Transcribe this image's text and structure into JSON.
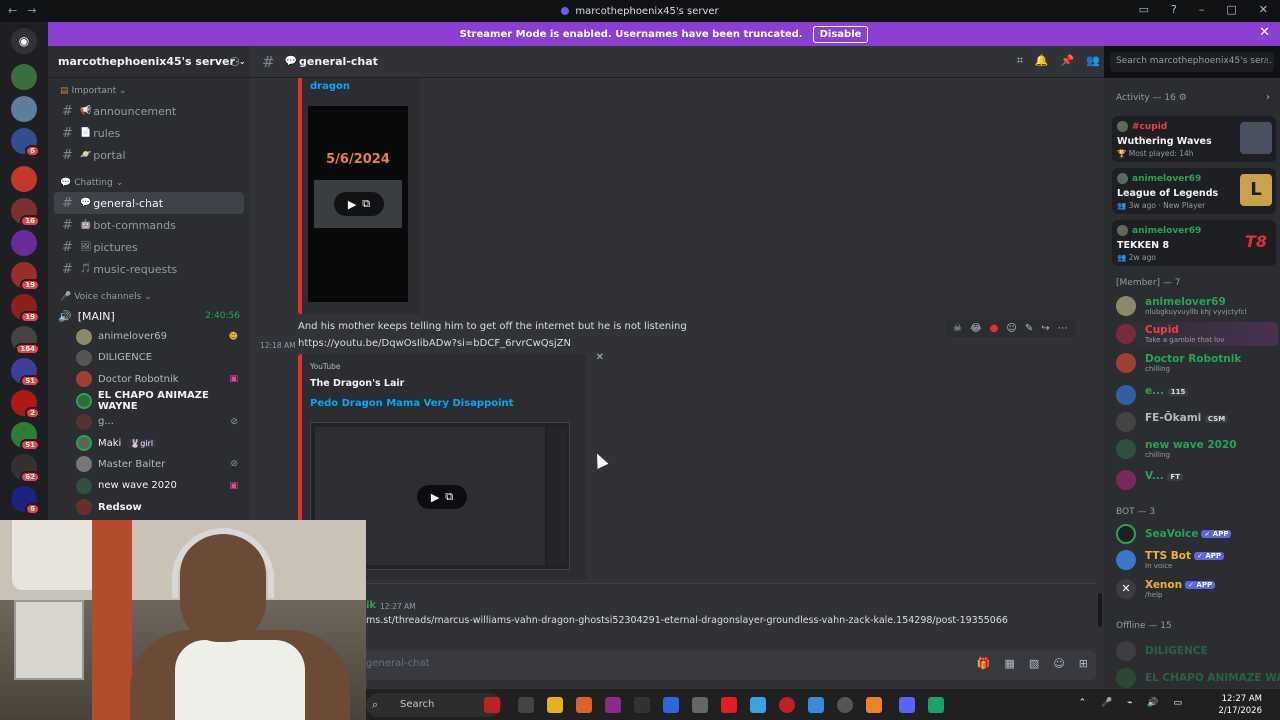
{
  "window": {
    "title": "marcothephoenix45's server"
  },
  "banner": {
    "text": "Streamer Mode is enabled. Usernames have been truncated.",
    "disable_label": "Disable"
  },
  "server": {
    "name": "marcothephoenix45's server"
  },
  "server_badges": [
    "6",
    "16",
    "19",
    "19",
    "164",
    "51",
    "2",
    "51",
    "62",
    "6"
  ],
  "sidebar": {
    "categories": {
      "important": "Important",
      "chatting": "Chatting",
      "voice": "Voice channels"
    },
    "important_channels": [
      {
        "emoji": "📢",
        "label": "announcement"
      },
      {
        "emoji": "📄",
        "label": "rules"
      },
      {
        "emoji": "🪐",
        "label": "portal"
      }
    ],
    "chatting_channels": [
      {
        "emoji": "💬",
        "label": "general-chat"
      },
      {
        "emoji": "🤖",
        "label": "bot-commands"
      },
      {
        "emoji": "🖼",
        "label": "pictures"
      },
      {
        "emoji": "🎵",
        "label": "music-requests"
      }
    ],
    "voice_channel": {
      "name": "[MAIN]",
      "timer": "2:40:56"
    },
    "voice_users": [
      "animelover69",
      "DILIGENCE",
      "Doctor Robotnik",
      "EL CHAPO ANIMAZE WAYNE",
      "g...",
      "Maki",
      "Master Baiter",
      "new wave 2020",
      "Redsow"
    ],
    "maki_tag": "girl"
  },
  "chat_header": {
    "channel": "general-chat",
    "search_placeholder": "Search marcothephoenix45's ser..."
  },
  "messages": {
    "embed1": {
      "title": "dragon",
      "video_date": "5/6/2024"
    },
    "text1": "And his mother keeps telling him to get off the internet but he is not listening",
    "time1": "12:18 AM",
    "link1": "https://youtu.be/DqwOsIibADw?si=bDCF_6rvrCwQsjZN",
    "embed2": {
      "provider": "YouTube",
      "author": "The Dragon's Lair",
      "title": "Pedo Dragon Mama Very Disappoint"
    },
    "user2_fragment": "ik",
    "time2": "12:27 AM",
    "link2": "ms.st/threads/marcus-williams-vahn-dragon-ghostsi52304291-eternal-dragonslayer-groundless-vahn-zack-kale.154298/post-19355066"
  },
  "composer": {
    "placeholder": "general-chat"
  },
  "members": {
    "activity_header": "Activity — 16",
    "activity_cards": [
      {
        "user": "#cupid",
        "game": "Wuthering Waves",
        "sub": "Most played: 14h",
        "user_color": "#f23f43"
      },
      {
        "user": "animelover69",
        "game": "League of Legends",
        "sub": "3w ago · New Player",
        "user_color": "#23a55a"
      },
      {
        "user": "animelover69",
        "game": "TEKKEN 8",
        "sub": "2w ago",
        "user_color": "#23a55a"
      }
    ],
    "member_header": "[Member] — 7",
    "member_list": [
      {
        "name": "animelover69",
        "sub": "nlubgkuyvuyllb khj vyvjctyfcl",
        "color": "#23a55a"
      },
      {
        "name": "Cupid",
        "sub": "Take a gamble that lov",
        "color": "#f23f43"
      },
      {
        "name": "Doctor Robotnik",
        "sub": "chilling",
        "color": "#23a55a"
      },
      {
        "name": "e...",
        "sub": "",
        "color": "#23a55a",
        "tag": "115"
      },
      {
        "name": "FE-Ōkami",
        "sub": "",
        "color": "#b5bac1",
        "tag": "CSM"
      },
      {
        "name": "new wave 2020",
        "sub": "chilling",
        "color": "#23a55a"
      },
      {
        "name": "V...",
        "sub": "",
        "color": "#23a55a",
        "tag": "FT"
      }
    ],
    "bot_header": "BOT — 3",
    "bots": [
      {
        "name": "SeaVoice",
        "sub": "",
        "color": "#23a55a"
      },
      {
        "name": "TTS Bot",
        "sub": "In voice",
        "color": "#f0b232"
      },
      {
        "name": "Xenon",
        "sub": "/help",
        "color": "#f0b232"
      }
    ],
    "app_tag": "APP",
    "offline_header": "Offline — 15",
    "offline": [
      "DILIGENCE",
      "EL CHAPO ANIMAZE WA..."
    ]
  },
  "taskbar": {
    "search_label": "Search",
    "time": "12:27 AM",
    "date": "2/17/2026"
  },
  "colors": {
    "banner": "#8a3fd1",
    "accent": "#5865f2",
    "online": "#23a55a",
    "link": "#00a8fc",
    "embed_border": "#e53030"
  }
}
